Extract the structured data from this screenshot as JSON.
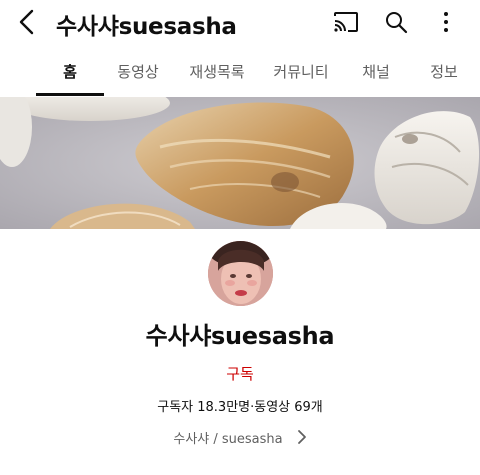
{
  "header": {
    "title": "수사샤suesasha",
    "back_icon": "back-arrow-icon",
    "cast_icon": "cast-icon",
    "search_icon": "search-icon",
    "more_icon": "more-vertical-icon"
  },
  "tabs": [
    {
      "label": "홈",
      "active": true
    },
    {
      "label": "동영상",
      "active": false
    },
    {
      "label": "재생목록",
      "active": false
    },
    {
      "label": "커뮤니티",
      "active": false
    },
    {
      "label": "채널",
      "active": false
    },
    {
      "label": "정보",
      "active": false
    }
  ],
  "channel": {
    "name": "수사샤suesasha",
    "subscribe_label": "구독",
    "stats": "구독자 18.3만명·동영상 69개",
    "handle": "수사샤 / suesasha",
    "handle_icon": "chevron-right-icon"
  },
  "colors": {
    "subscribe": "#cc0000",
    "text_primary": "#0f0f0f",
    "text_secondary": "#606060"
  }
}
